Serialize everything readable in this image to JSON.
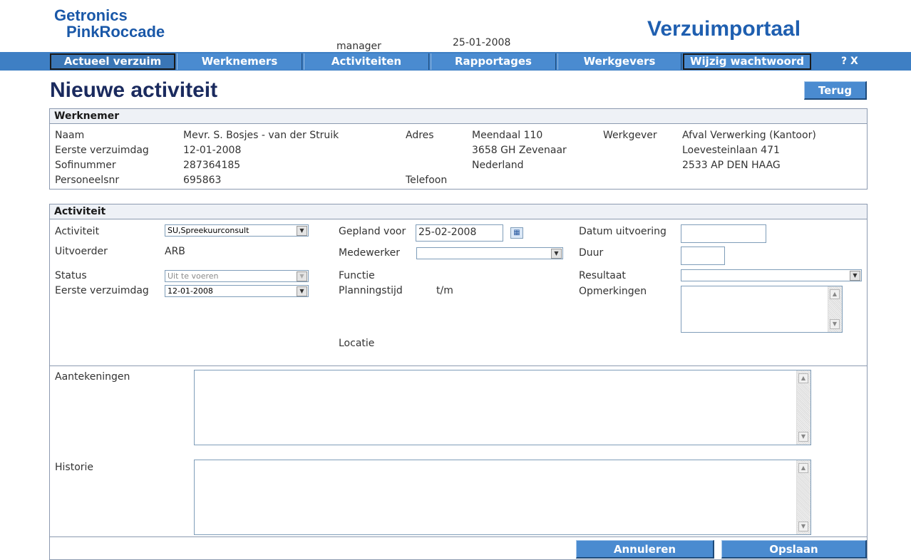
{
  "header": {
    "logo_line1": "Getronics",
    "logo_line2": "PinkRoccade",
    "user": "manager",
    "date": "25-01-2008",
    "app_title": "Verzuimportaal"
  },
  "nav": {
    "items": [
      {
        "label": "Actueel verzuim"
      },
      {
        "label": "Werknemers"
      },
      {
        "label": "Activiteiten"
      },
      {
        "label": "Rapportages"
      },
      {
        "label": "Werkgevers"
      },
      {
        "label": "Wijzig wachtwoord"
      }
    ],
    "help": "? X"
  },
  "page": {
    "title": "Nieuwe activiteit",
    "back_label": "Terug"
  },
  "werknemer": {
    "heading": "Werknemer",
    "naam_label": "Naam",
    "naam_value": "Mevr. S. Bosjes - van der Struik",
    "eerste_label": "Eerste verzuimdag",
    "eerste_value": "12-01-2008",
    "sofi_label": "Sofinummer",
    "sofi_value": "287364185",
    "pers_label": "Personeelsnr",
    "pers_value": "695863",
    "adres_label": "Adres",
    "adres_line1": "Meendaal 110",
    "adres_line2": "3658 GH Zevenaar",
    "adres_line3": "Nederland",
    "telefoon_label": "Telefoon",
    "werkgever_label": "Werkgever",
    "werkgever_line1": "Afval Verwerking (Kantoor)",
    "werkgever_line2": "Loevesteinlaan 471",
    "werkgever_line3": "2533 AP DEN HAAG"
  },
  "activiteit": {
    "heading": "Activiteit",
    "activiteit_label": "Activiteit",
    "activiteit_value": "SU,Spreekuurconsult",
    "uitvoerder_label": "Uitvoerder",
    "uitvoerder_value": "ARB",
    "status_label": "Status",
    "status_value": "Uit te voeren",
    "eerste_label": "Eerste verzuimdag",
    "eerste_value": "12-01-2008",
    "gepland_label": "Gepland voor",
    "gepland_value": "25-02-2008",
    "medewerker_label": "Medewerker",
    "medewerker_value": "",
    "functie_label": "Functie",
    "planningstijd_label": "Planningstijd",
    "tm_label": "t/m",
    "locatie_label": "Locatie",
    "datum_label": "Datum uitvoering",
    "datum_value": "",
    "duur_label": "Duur",
    "duur_value": "",
    "resultaat_label": "Resultaat",
    "resultaat_value": "",
    "opmerkingen_label": "Opmerkingen"
  },
  "notes": {
    "aantekeningen_label": "Aantekeningen",
    "historie_label": "Historie"
  },
  "footer": {
    "cancel_label": "Annuleren",
    "save_label": "Opslaan"
  },
  "colors": {
    "nav_blue": "#4a8bd0",
    "title_navy": "#1a2a5e",
    "brand_blue": "#1f5fb0"
  }
}
